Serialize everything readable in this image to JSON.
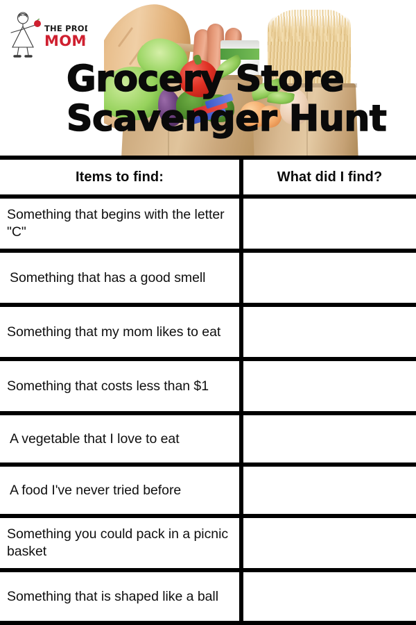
{
  "document": {
    "title_line1": "Grocery Store",
    "title_line2": "Scavenger Hunt",
    "background_color": "#ffffff",
    "rule_color": "#000000",
    "text_color": "#0f0f0f"
  },
  "logo": {
    "name": "the-produce-moms-logo",
    "line1": "THE PRODUCE",
    "line2": "MOMS",
    "line1_color": "#1a1a1a",
    "line2_color": "#cf2030",
    "accent_color": "#cf2030",
    "figure": "stick-figure-woman-holding-apple"
  },
  "banner": {
    "name": "grocery-bag-photo",
    "alt": "Brown paper grocery bag filled with groceries",
    "items_depicted": [
      "baguette",
      "hot dogs",
      "spaghetti",
      "red bell pepper",
      "broccoli",
      "lettuce",
      "green onions",
      "eggplant",
      "milk carton",
      "egg",
      "peach",
      "paper bag"
    ],
    "colors": {
      "bag": "#d2ae82",
      "bread": "#e2b179",
      "pasta": "#e9cd96",
      "sausage": "#e69a79",
      "pepper": "#e03124",
      "greens": "#8dc955",
      "eggplant": "#6a3f7c"
    }
  },
  "table": {
    "headers": {
      "items": "Items to find:",
      "answers": "What did I find?"
    },
    "rows": [
      {
        "item": "Something that begins with the letter \"C\"",
        "answer": ""
      },
      {
        "item": "Something that has a good smell",
        "answer": ""
      },
      {
        "item": "Something that my mom likes to eat",
        "answer": ""
      },
      {
        "item": "Something that costs less than $1",
        "answer": ""
      },
      {
        "item": "A vegetable that I love to eat",
        "answer": ""
      },
      {
        "item": "A food I've never tried before",
        "answer": ""
      },
      {
        "item": "Something you could pack in a picnic basket",
        "answer": ""
      },
      {
        "item": "Something that is shaped like a ball",
        "answer": ""
      }
    ]
  }
}
